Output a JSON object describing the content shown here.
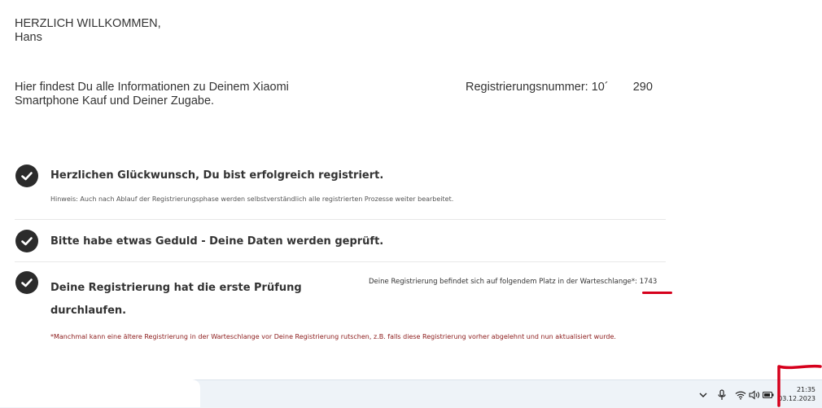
{
  "header": {
    "welcome_line1": "HERZLICH WILLKOMMEN,",
    "welcome_line2": "Hans",
    "info_line1": "Hier findest Du alle Informationen zu Deinem Xiaomi",
    "info_line2": "Smartphone Kauf und Deiner Zugabe.",
    "registration_label": "Registrierungsnummer: 10´",
    "registration_suffix": "290"
  },
  "steps": [
    {
      "title": "Herzlichen Glückwunsch, Du bist erfolgreich registriert.",
      "hint": "Hinweis: Auch nach Ablauf der Registrierungsphase werden selbstverständlich alle registrierten Prozesse weiter bearbeitet."
    },
    {
      "title": "Bitte habe etwas Geduld - Deine Daten werden geprüft."
    },
    {
      "title_line1": "Deine Registrierung hat die erste Prüfung",
      "title_line2": "durchlaufen.",
      "queue_text": "Deine Registrierung befindet sich auf folgendem Platz in der Warteschlange*: ",
      "queue_position": "1743",
      "footnote": "*Manchmal kann eine ältere Registrierung in der Warteschlange vor Deine Registrierung rutschen, z.B. falls diese Registrierung vorher abgelehnt und nun aktualisiert wurde."
    }
  ],
  "taskbar": {
    "time": "21:35",
    "date": "03.12.2023",
    "icons": [
      "chevron-up-icon",
      "microphone-icon",
      "wifi-icon",
      "speaker-icon",
      "battery-icon"
    ]
  },
  "colors": {
    "annotation_red": "#d6001c",
    "footnote_red": "#8b1a1a",
    "check_dark": "#2b2b2b"
  }
}
